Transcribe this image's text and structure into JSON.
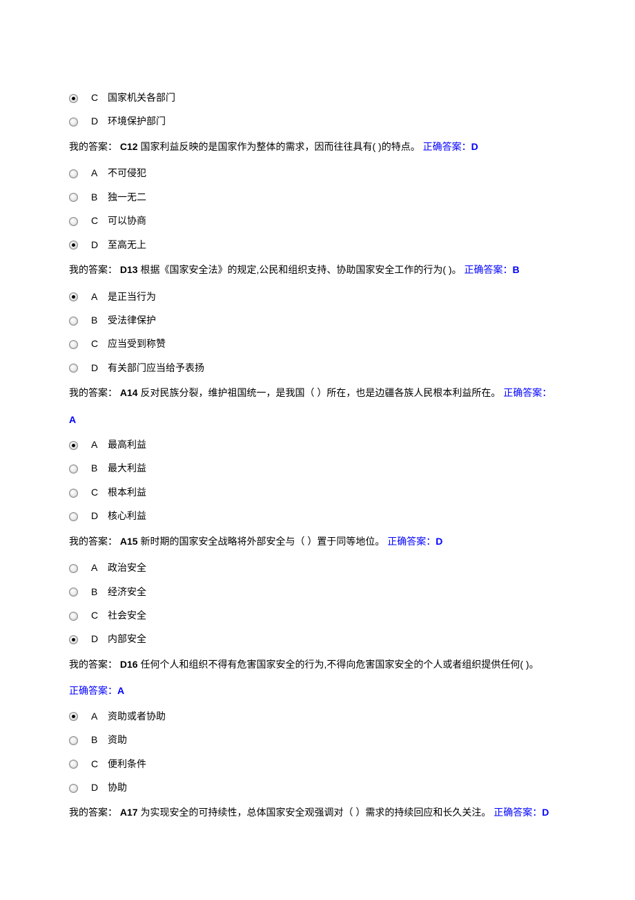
{
  "labels": {
    "myAnswer": "我的答案：",
    "correctAnswer": "正确答案："
  },
  "q11_options_tail": [
    {
      "letter": "C",
      "text": "国家机关各部门",
      "selected": true
    },
    {
      "letter": "D",
      "text": "环境保护部门",
      "selected": false
    }
  ],
  "q12": {
    "prev_my_answer": "C",
    "qnum": "12",
    "text": " 国家利益反映的是国家作为整体的需求，因而往往具有( )的特点。",
    "correct": "D",
    "options": [
      {
        "letter": "A",
        "text": "不可侵犯",
        "selected": false
      },
      {
        "letter": "B",
        "text": "独一无二",
        "selected": false
      },
      {
        "letter": "C",
        "text": "可以协商",
        "selected": false
      },
      {
        "letter": "D",
        "text": "至高无上",
        "selected": true
      }
    ]
  },
  "q13": {
    "prev_my_answer": "D",
    "qnum": "13",
    "text": " 根据《国家安全法》的规定,公民和组织支持、协助国家安全工作的行为( )。",
    "correct": "B",
    "options": [
      {
        "letter": "A",
        "text": "是正当行为",
        "selected": true
      },
      {
        "letter": "B",
        "text": "受法律保护",
        "selected": false
      },
      {
        "letter": "C",
        "text": "应当受到称赞",
        "selected": false
      },
      {
        "letter": "D",
        "text": "有关部门应当给予表扬",
        "selected": false
      }
    ]
  },
  "q14": {
    "prev_my_answer": "A",
    "qnum": "14",
    "text": " 反对民族分裂，维护祖国统一，是我国（ ）所在，也是边疆各族人民根本利益所在。",
    "correct": "A",
    "options": [
      {
        "letter": "A",
        "text": "最高利益",
        "selected": true
      },
      {
        "letter": "B",
        "text": "最大利益",
        "selected": false
      },
      {
        "letter": "C",
        "text": "根本利益",
        "selected": false
      },
      {
        "letter": "D",
        "text": "核心利益",
        "selected": false
      }
    ]
  },
  "q15": {
    "prev_my_answer": "A",
    "qnum": "15",
    "text": " 新时期的国家安全战略将外部安全与（ ）置于同等地位。",
    "correct": "D",
    "options": [
      {
        "letter": "A",
        "text": "政治安全",
        "selected": false
      },
      {
        "letter": "B",
        "text": "经济安全",
        "selected": false
      },
      {
        "letter": "C",
        "text": "社会安全",
        "selected": false
      },
      {
        "letter": "D",
        "text": "内部安全",
        "selected": true
      }
    ]
  },
  "q16": {
    "prev_my_answer": "D",
    "qnum": "16",
    "text": " 任何个人和组织不得有危害国家安全的行为,不得向危害国家安全的个人或者组织提供任何( )。",
    "correct": "A",
    "options": [
      {
        "letter": "A",
        "text": "资助或者协助",
        "selected": true
      },
      {
        "letter": "B",
        "text": "资助",
        "selected": false
      },
      {
        "letter": "C",
        "text": "便利条件",
        "selected": false
      },
      {
        "letter": "D",
        "text": "协助",
        "selected": false
      }
    ]
  },
  "q17": {
    "prev_my_answer": "A",
    "qnum": "17",
    "text": " 为实现安全的可持续性，总体国家安全观强调对（ ）需求的持续回应和长久关注。",
    "correct": "D"
  }
}
